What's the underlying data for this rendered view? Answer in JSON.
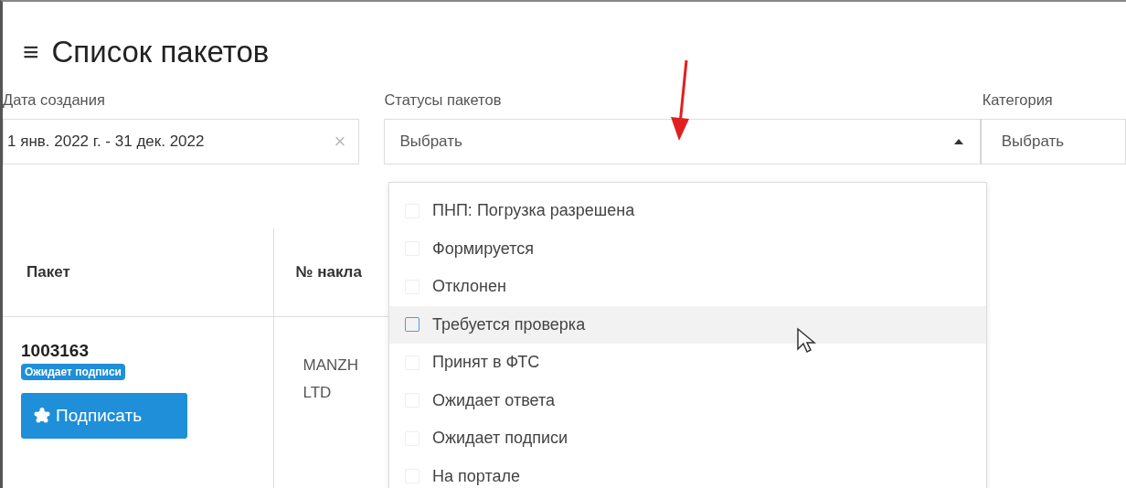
{
  "header": {
    "menu_icon": "≡",
    "title": "Список пакетов"
  },
  "filters": [
    {
      "kind": "date",
      "label": "Дата создания",
      "value": "1 янв. 2022 г. - 31 дек. 2022",
      "clear": "×"
    },
    {
      "kind": "multiselect",
      "label": "Статусы пакетов",
      "placeholder": "Выбрать",
      "expanded": true
    },
    {
      "kind": "select",
      "label": "Категория",
      "placeholder": "Выбрать"
    }
  ],
  "status_options": [
    {
      "label": "ПНП: Погрузка разрешена",
      "checked": false,
      "hovered": false
    },
    {
      "label": "Формируется",
      "checked": false,
      "hovered": false
    },
    {
      "label": "Отклонен",
      "checked": false,
      "hovered": false
    },
    {
      "label": "Требуется проверка",
      "checked": false,
      "hovered": true
    },
    {
      "label": "Принят в ФТС",
      "checked": false,
      "hovered": false
    },
    {
      "label": "Ожидает ответа",
      "checked": false,
      "hovered": false
    },
    {
      "label": "Ожидает подписи",
      "checked": false,
      "hovered": false
    },
    {
      "label": "На портале",
      "checked": false,
      "hovered": false
    }
  ],
  "table": {
    "columns": [
      "Пакет",
      "№ накла"
    ],
    "rows": [
      {
        "package": "1003163",
        "status": "Ожидает подписи",
        "action": "Подписать",
        "column_2": [
          "MANZH",
          "LTD"
        ]
      }
    ]
  }
}
